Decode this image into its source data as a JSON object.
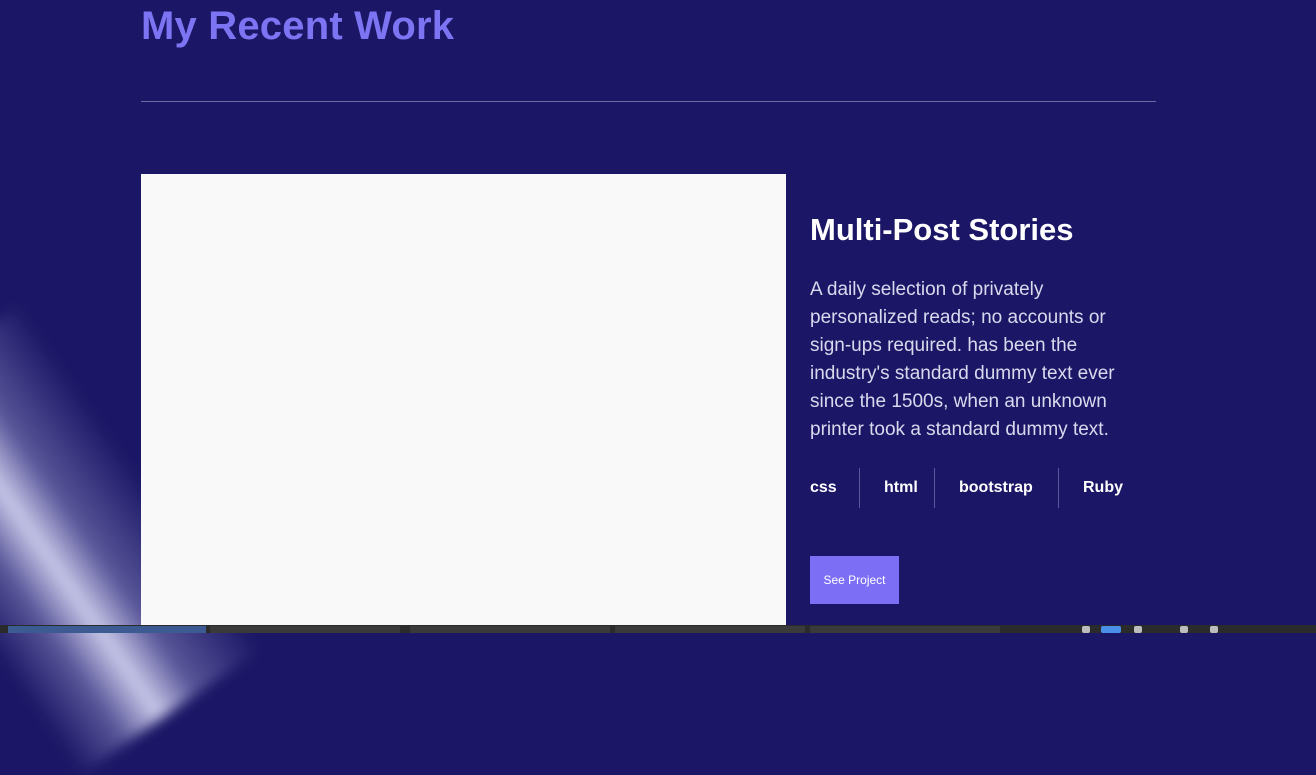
{
  "section": {
    "title": "My Recent Work"
  },
  "project": {
    "title": "Multi-Post Stories",
    "description": "A daily selection of privately personalized reads; no accounts or sign-ups required. has been the industry's standard dummy text ever since the 1500s, when an unknown printer took a standard dummy text.",
    "tags": [
      "css",
      "html",
      "bootstrap",
      "Ruby"
    ],
    "button_label": "See Project"
  },
  "colors": {
    "background": "#1b1766",
    "accent": "#7c74f2",
    "button": "#7c6ff5",
    "image_placeholder": "#f9f9f9"
  },
  "taskbar": {
    "icons": [
      "browser-icon",
      "file-icon",
      "editor-icon",
      "terminal-icon",
      "volume-icon",
      "network-icon",
      "battery-icon"
    ]
  }
}
